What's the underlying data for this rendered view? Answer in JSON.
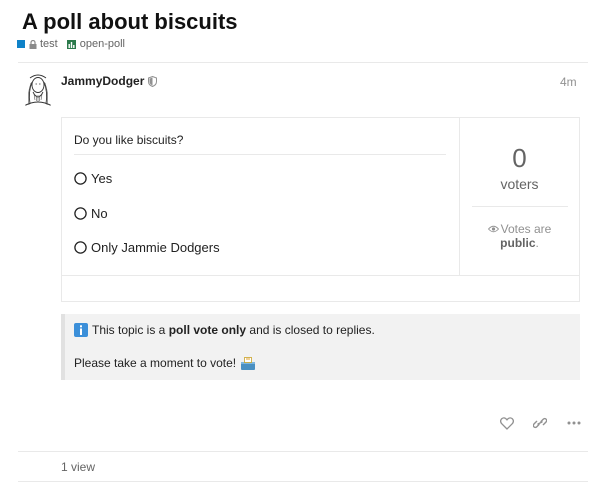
{
  "topic": {
    "title": "A poll about biscuits",
    "category": "test",
    "category_color": "#0f82c8",
    "tag": "open-poll",
    "tag_color": "#2b7a4b"
  },
  "post": {
    "username": "JammyDodger",
    "time": "4m",
    "avatar_icon": "avatar-portrait",
    "moderator_icon": "shield-icon"
  },
  "poll": {
    "question": "Do you like biscuits?",
    "options": [
      "Yes",
      "No",
      "Only Jammie Dodgers"
    ],
    "voter_count": "0",
    "voter_label": "voters",
    "public_prefix": "Votes are",
    "public_bold": "public",
    "public_suffix": "."
  },
  "notice": {
    "before": "This topic is a",
    "bold": "poll vote only",
    "after": "and is closed to replies.",
    "line2": "Please take a moment to vote!",
    "info_color": "#3b8fd9"
  },
  "footer": {
    "views": "1 view"
  }
}
